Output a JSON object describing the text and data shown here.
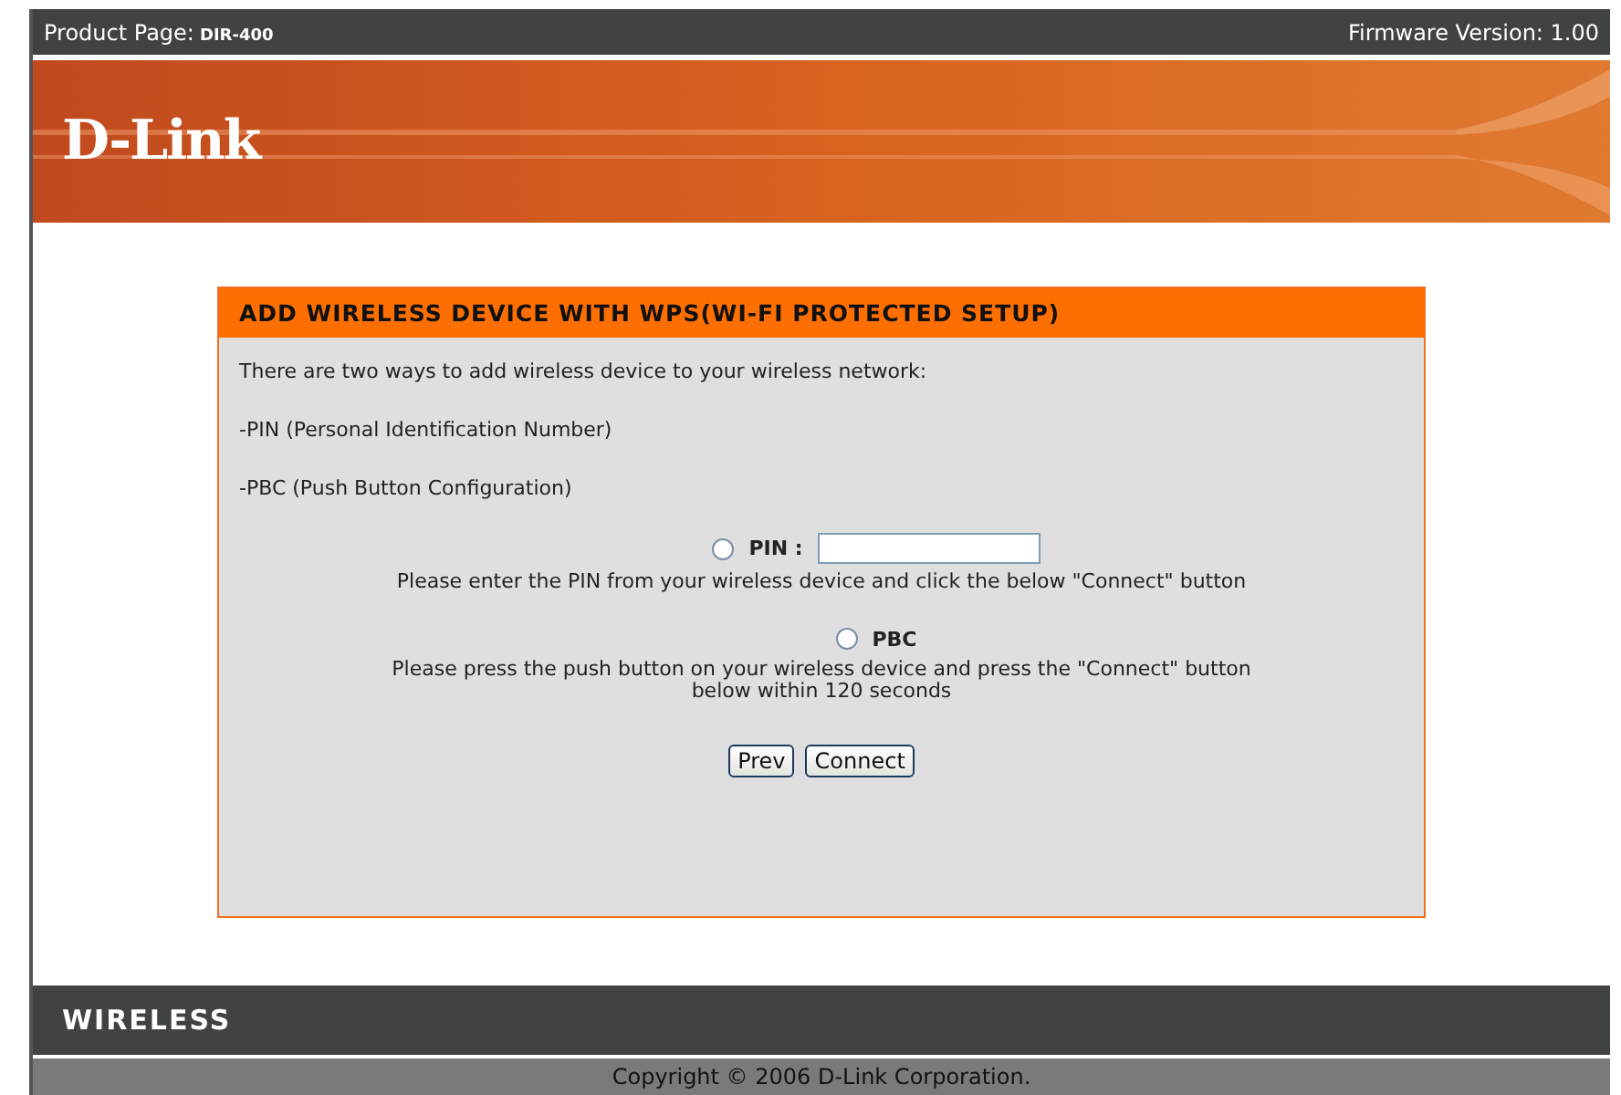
{
  "top_bar": {
    "product_label": "Product Page:",
    "product_model": "DIR-400",
    "firmware": "Firmware Version: 1.00"
  },
  "banner": {
    "logo": "D-Link"
  },
  "panel": {
    "title": "ADD WIRELESS DEVICE WITH WPS(WI-FI PROTECTED SETUP)",
    "intro": [
      "There are two ways to add wireless device to your wireless network:",
      "-PIN (Personal Identification Number)",
      "-PBC (Push Button Configuration)"
    ],
    "options": [
      {
        "kind": "pin",
        "label": "PIN :",
        "selected": false,
        "help": [
          "Please enter the PIN from your wireless device and click the below \"Connect\" button"
        ]
      },
      {
        "kind": "pbc",
        "label": "PBC",
        "selected": false,
        "help": [
          "Please press the push button on your wireless device and press the \"Connect\" button",
          "below within 120 seconds"
        ]
      }
    ],
    "buttons": [
      "Prev",
      "Connect"
    ]
  },
  "footer": {
    "brand": "WIRELESS",
    "copyright": "Copyright © 2006 D-Link Corporation."
  }
}
